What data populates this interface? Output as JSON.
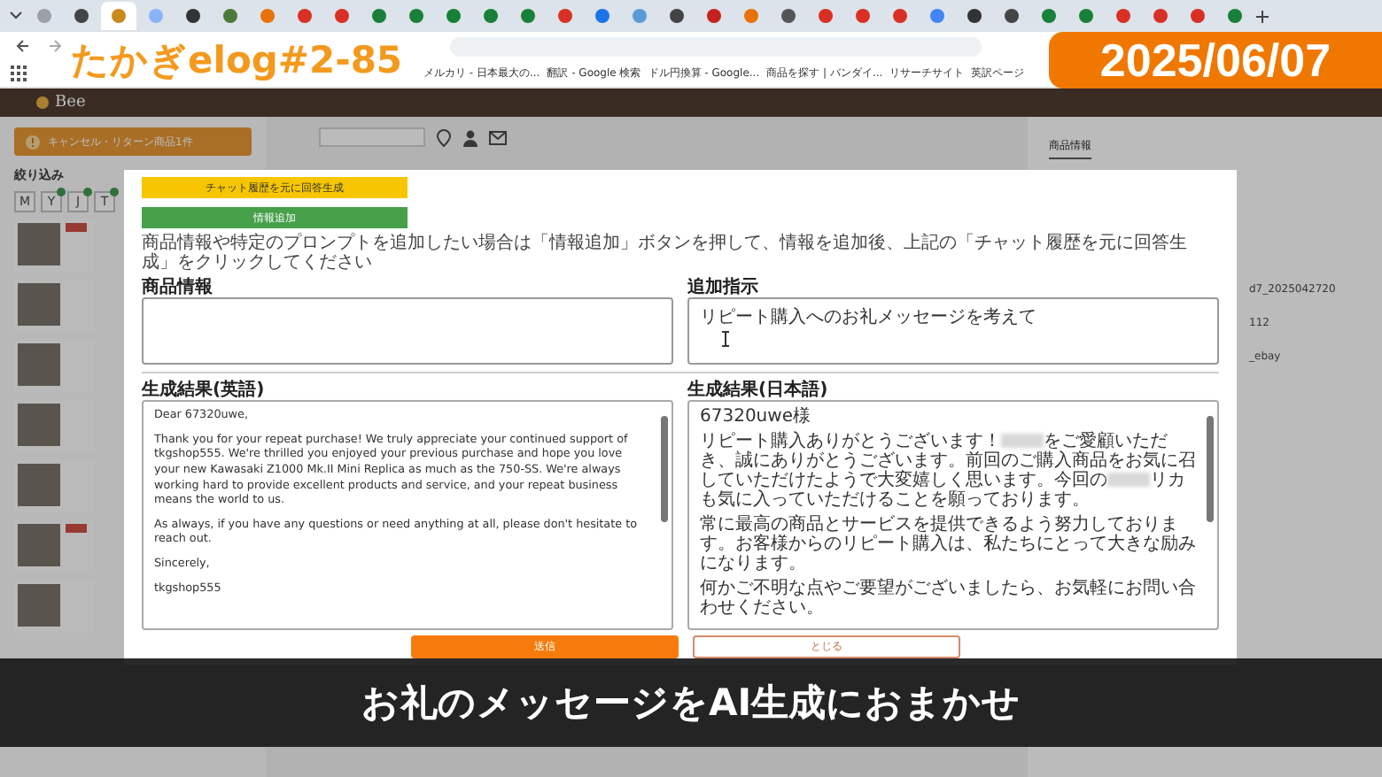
{
  "browser": {
    "tabs": [
      {
        "color": "#9aa0a6",
        "selected": false
      },
      {
        "color": "#444444",
        "selected": false
      },
      {
        "color": "#c98a1b",
        "selected": true
      },
      {
        "color": "#8ab4f8",
        "selected": false
      },
      {
        "color": "#333333",
        "selected": false
      },
      {
        "color": "#4c7a3a",
        "selected": false
      },
      {
        "color": "#e8710a",
        "selected": false
      },
      {
        "color": "#d93025",
        "selected": false
      },
      {
        "color": "#d93025",
        "selected": false
      },
      {
        "color": "#188038",
        "selected": false
      },
      {
        "color": "#188038",
        "selected": false
      },
      {
        "color": "#188038",
        "selected": false
      },
      {
        "color": "#188038",
        "selected": false
      },
      {
        "color": "#188038",
        "selected": false
      },
      {
        "color": "#d93025",
        "selected": false
      },
      {
        "color": "#1a73e8",
        "selected": false
      },
      {
        "color": "#5b9bd5",
        "selected": false
      },
      {
        "color": "#444444",
        "selected": false
      },
      {
        "color": "#c5221f",
        "selected": false
      },
      {
        "color": "#e8710a",
        "selected": false
      },
      {
        "color": "#555555",
        "selected": false
      },
      {
        "color": "#d93025",
        "selected": false
      },
      {
        "color": "#d93025",
        "selected": false
      },
      {
        "color": "#d93025",
        "selected": false
      },
      {
        "color": "#4285f4",
        "selected": false
      },
      {
        "color": "#333333",
        "selected": false
      },
      {
        "color": "#444444",
        "selected": false
      },
      {
        "color": "#188038",
        "selected": false
      },
      {
        "color": "#188038",
        "selected": false
      },
      {
        "color": "#d93025",
        "selected": false
      },
      {
        "color": "#d93025",
        "selected": false
      },
      {
        "color": "#d93025",
        "selected": false
      },
      {
        "color": "#188038",
        "selected": false
      }
    ],
    "bookmarks": [
      "メルカリ - 日本最大の...",
      "翻訳 - Google 検索",
      "ドル円換算 - Google...",
      "商品を探す | バンダイ...",
      "リサーチサイト",
      "英訳ページ"
    ]
  },
  "app": {
    "logo": "Bee",
    "sidebar": {
      "notice": "キャンセル・リターン商品1件",
      "filter_heading": "絞り込み",
      "filters": [
        {
          "label": "M",
          "badge": false
        },
        {
          "label": "Y",
          "badge": true
        },
        {
          "label": "J",
          "badge": true
        },
        {
          "label": "T",
          "badge": true
        }
      ],
      "items": [
        {
          "tagged": true
        },
        {
          "tagged": false
        },
        {
          "tagged": false
        },
        {
          "tagged": false
        },
        {
          "tagged": false
        },
        {
          "tagged": true
        },
        {
          "tagged": false
        }
      ]
    },
    "right_panel": {
      "tab": "商品情報",
      "fields": [
        "d7_2025042720",
        "112",
        "_ebay"
      ]
    }
  },
  "modal": {
    "buttons": [
      {
        "kind": "generate",
        "label": "チャット履歴を元に回答生成"
      },
      {
        "kind": "add",
        "label": "情報追加"
      }
    ],
    "hint": "商品情報や特定のプロンプトを追加したい場合は「情報追加」ボタンを押して、情報を追加後、上記の「チャット履歴を元に回答生成」をクリックしてください",
    "inputs": [
      {
        "label": "商品情報"
      },
      {
        "label": "追加指示",
        "value": "リピート購入へのお礼メッセージを考えて"
      }
    ],
    "results": [
      {
        "label": "生成結果(英語)",
        "paragraphs": [
          [
            {
              "kind": "text",
              "text": "Dear 67320uwe,"
            }
          ],
          [
            {
              "kind": "text",
              "text": "Thank you for your repeat purchase! We truly appreciate your continued support of tkgshop555.  We're thrilled you enjoyed your previous purchase and hope you love your new Kawasaki Z1000 Mk.II Mini Replica as much as the 750-SS.  We're always working hard to provide excellent products and service, and your repeat business means the world to us."
            }
          ],
          [
            {
              "kind": "text",
              "text": "As always, if you have any questions or need anything at all, please don't hesitate to reach out."
            }
          ],
          [
            {
              "kind": "text",
              "text": "Sincerely,"
            }
          ],
          [
            {
              "kind": "text",
              "text": "tkgshop555"
            }
          ]
        ]
      },
      {
        "label": "生成結果(日本語)",
        "paragraphs": [
          [
            {
              "kind": "text",
              "text": "67320uwe様"
            }
          ],
          [
            {
              "kind": "text",
              "text": "リピート購入ありがとうございます！"
            },
            {
              "kind": "redacted"
            },
            {
              "kind": "text",
              "text": "をご愛顧いただき、誠にありがとうございます。前回のご購入商品をお気に召していただけたようで大変嬉しく思います。今回の"
            },
            {
              "kind": "redacted"
            },
            {
              "kind": "text",
              "text": "リカも気に入っていただけることを願っております。"
            }
          ],
          [
            {
              "kind": "text",
              "text": "常に最高の商品とサービスを提供できるよう努力しております。お客様からのリピート購入は、私たちにとって大きな励みになります。"
            }
          ],
          [
            {
              "kind": "text",
              "text": "何かご不明な点やご要望がございましたら、お気軽にお問い合わせください。"
            }
          ]
        ]
      }
    ],
    "actions": [
      {
        "kind": "primary",
        "label": "送信"
      },
      {
        "kind": "secondary",
        "label": "とじる"
      }
    ]
  },
  "video_overlay": {
    "title": "たかぎelog#2-85",
    "date": "2025/06/07",
    "caption": "お礼のメッセージをAI生成におまかせ"
  }
}
